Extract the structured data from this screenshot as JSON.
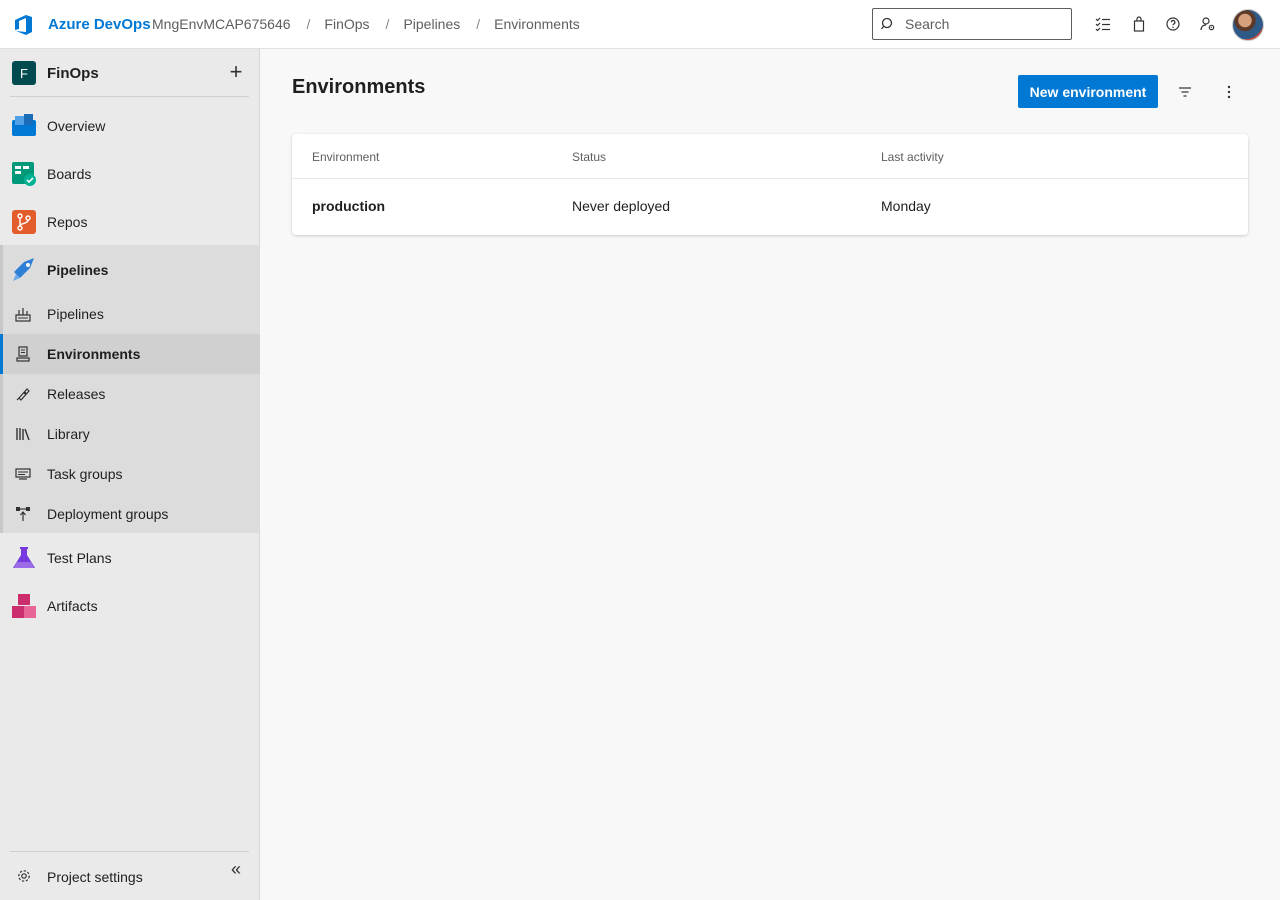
{
  "header": {
    "brand": "Azure DevOps",
    "breadcrumbs": [
      "MngEnvMCAP675646",
      "FinOps",
      "Pipelines",
      "Environments"
    ],
    "search_placeholder": "Search"
  },
  "project": {
    "initial": "F",
    "name": "FinOps",
    "add_label": "+"
  },
  "sidebar": {
    "items": [
      {
        "label": "Overview",
        "icon": "overview-icon"
      },
      {
        "label": "Boards",
        "icon": "boards-icon"
      },
      {
        "label": "Repos",
        "icon": "repos-icon"
      },
      {
        "label": "Pipelines",
        "icon": "pipelines-icon"
      }
    ],
    "sub_items": [
      {
        "label": "Pipelines",
        "icon": "pipelines-sub-icon"
      },
      {
        "label": "Environments",
        "icon": "environments-icon",
        "selected": true
      },
      {
        "label": "Releases",
        "icon": "releases-icon"
      },
      {
        "label": "Library",
        "icon": "library-icon"
      },
      {
        "label": "Task groups",
        "icon": "task-groups-icon"
      },
      {
        "label": "Deployment groups",
        "icon": "deployment-groups-icon"
      }
    ],
    "bottom_items": [
      {
        "label": "Test Plans",
        "icon": "test-plans-icon"
      },
      {
        "label": "Artifacts",
        "icon": "artifacts-icon"
      }
    ],
    "settings_label": "Project settings",
    "collapse_label": "«"
  },
  "main": {
    "title": "Environments",
    "new_button": "New environment",
    "table": {
      "columns": [
        "Environment",
        "Status",
        "Last activity"
      ],
      "rows": [
        {
          "environment": "production",
          "status": "Never deployed",
          "last_activity": "Monday"
        }
      ]
    }
  },
  "colors": {
    "accent": "#0078d4",
    "project_badge": "#004b50"
  }
}
